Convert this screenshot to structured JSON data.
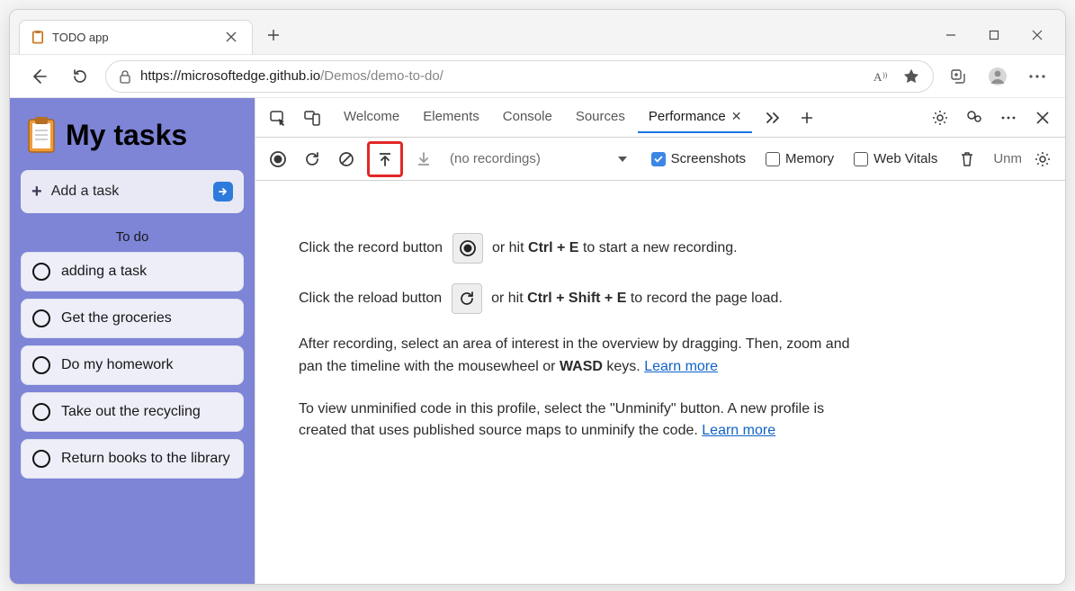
{
  "window": {
    "tab_title": "TODO app",
    "url_host": "https://microsoftedge.github.io",
    "url_path": "/Demos/demo-to-do/"
  },
  "app": {
    "title": "My tasks",
    "add_task_label": "Add a task",
    "todo_header": "To do",
    "tasks": [
      "adding a task",
      "Get the groceries",
      "Do my homework",
      "Take out the recycling",
      "Return books to the library"
    ]
  },
  "devtools": {
    "tabs": {
      "welcome": "Welcome",
      "elements": "Elements",
      "console": "Console",
      "sources": "Sources",
      "performance": "Performance"
    },
    "toolbar": {
      "no_recordings": "(no recordings)",
      "screenshots": "Screenshots",
      "memory": "Memory",
      "web_vitals": "Web Vitals",
      "unm": "Unm"
    },
    "help": {
      "p1_a": "Click the record button",
      "p1_b": "or hit",
      "p1_kbd1": "Ctrl + E",
      "p1_c": "to start a new recording.",
      "p2_a": "Click the reload button",
      "p2_b": "or hit",
      "p2_kbd1": "Ctrl + Shift + E",
      "p2_c": "to record the page load.",
      "p3_a": "After recording, select an area of interest in the overview by dragging. Then, zoom and pan the timeline with the mousewheel or",
      "p3_kbd": "WASD",
      "p3_b": "keys.",
      "p3_link": "Learn more",
      "p4_a": "To view unminified code in this profile, select the \"Unminify\" button. A new profile is created that uses published source maps to unminify the code.",
      "p4_link": "Learn more"
    }
  }
}
